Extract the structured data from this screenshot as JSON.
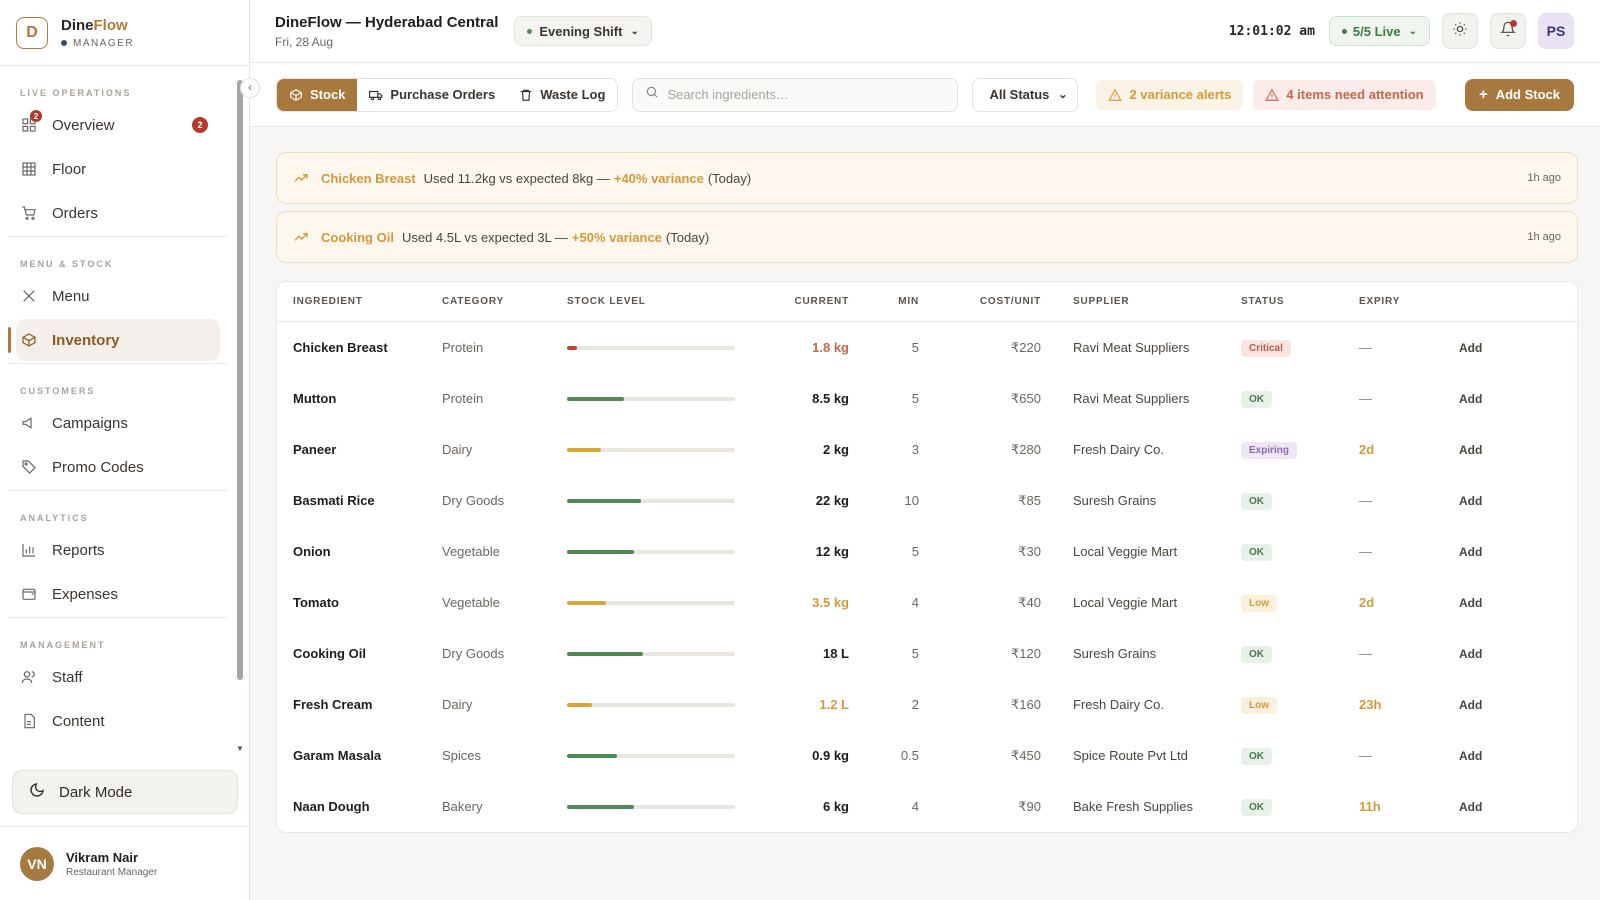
{
  "brand": {
    "name_part1": "Dine",
    "name_part2": "Flow",
    "role": "MANAGER",
    "logo_letter": "D"
  },
  "sidebar": {
    "sections": [
      {
        "label": "LIVE OPERATIONS",
        "items": [
          {
            "label": "Overview",
            "icon": "dashboard-icon",
            "badge": "2",
            "active": false
          },
          {
            "label": "Floor",
            "icon": "grid-icon",
            "active": false
          },
          {
            "label": "Orders",
            "icon": "cart-icon",
            "active": false
          }
        ]
      },
      {
        "label": "MENU & STOCK",
        "items": [
          {
            "label": "Menu",
            "icon": "utensils-icon",
            "active": false
          },
          {
            "label": "Inventory",
            "icon": "package-icon",
            "active": true
          }
        ]
      },
      {
        "label": "CUSTOMERS",
        "items": [
          {
            "label": "Campaigns",
            "icon": "megaphone-icon",
            "active": false
          },
          {
            "label": "Promo Codes",
            "icon": "tag-icon",
            "active": false
          }
        ]
      },
      {
        "label": "ANALYTICS",
        "items": [
          {
            "label": "Reports",
            "icon": "bar-chart-icon",
            "active": false
          },
          {
            "label": "Expenses",
            "icon": "wallet-icon",
            "active": false
          }
        ]
      },
      {
        "label": "MANAGEMENT",
        "items": [
          {
            "label": "Staff",
            "icon": "users-icon",
            "active": false
          },
          {
            "label": "Content",
            "icon": "file-icon",
            "active": false
          }
        ]
      }
    ],
    "dark_mode_label": "Dark Mode",
    "user": {
      "initials": "VN",
      "name": "Vikram Nair",
      "role": "Restaurant Manager"
    }
  },
  "header": {
    "title": "DineFlow — Hyderabad Central",
    "date": "Fri, 28 Aug",
    "shift": "Evening Shift",
    "clock": "12:01:02 am",
    "live": "5/5 Live",
    "avatar": "PS"
  },
  "toolbar": {
    "tabs": [
      {
        "label": "Stock",
        "active": true
      },
      {
        "label": "Purchase Orders",
        "active": false
      },
      {
        "label": "Waste Log",
        "active": false
      }
    ],
    "search_placeholder": "Search ingredients…",
    "status_filter": "All Status",
    "variance_alerts": "2 variance alerts",
    "attention_alerts": "4 items need attention",
    "add_stock": "Add Stock"
  },
  "alerts": [
    {
      "item": "Chicken Breast",
      "text": "Used 11.2kg vs expected 8kg —",
      "variance": "+40% variance",
      "period": "(Today)",
      "time": "1h ago"
    },
    {
      "item": "Cooking Oil",
      "text": "Used 4.5L vs expected 3L —",
      "variance": "+50% variance",
      "period": "(Today)",
      "time": "1h ago"
    }
  ],
  "table": {
    "columns": [
      "INGREDIENT",
      "CATEGORY",
      "STOCK LEVEL",
      "CURRENT",
      "MIN",
      "COST/UNIT",
      "SUPPLIER",
      "STATUS",
      "EXPIRY"
    ],
    "action_label": "Add",
    "rows": [
      {
        "ingredient": "Chicken Breast",
        "category": "Protein",
        "level": 0.06,
        "level_color": "#c0463a",
        "current": "1.8 kg",
        "current_style": "crit",
        "min": "5",
        "cost": "₹220",
        "supplier": "Ravi Meat Suppliers",
        "status": "Critical",
        "status_style": "critical",
        "expiry": "—",
        "expiry_style": ""
      },
      {
        "ingredient": "Mutton",
        "category": "Protein",
        "level": 0.34,
        "level_color": "#4e8a52",
        "current": "8.5 kg",
        "current_style": "",
        "min": "5",
        "cost": "₹650",
        "supplier": "Ravi Meat Suppliers",
        "status": "OK",
        "status_style": "ok",
        "expiry": "—",
        "expiry_style": ""
      },
      {
        "ingredient": "Paneer",
        "category": "Dairy",
        "level": 0.2,
        "level_color": "#d9a63a",
        "current": "2 kg",
        "current_style": "",
        "min": "3",
        "cost": "₹280",
        "supplier": "Fresh Dairy Co.",
        "status": "Expiring",
        "status_style": "expiring",
        "expiry": "2d",
        "expiry_style": "warn"
      },
      {
        "ingredient": "Basmati Rice",
        "category": "Dry Goods",
        "level": 0.44,
        "level_color": "#4e8a52",
        "current": "22 kg",
        "current_style": "",
        "min": "10",
        "cost": "₹85",
        "supplier": "Suresh Grains",
        "status": "OK",
        "status_style": "ok",
        "expiry": "—",
        "expiry_style": ""
      },
      {
        "ingredient": "Onion",
        "category": "Vegetable",
        "level": 0.4,
        "level_color": "#4e8a52",
        "current": "12 kg",
        "current_style": "",
        "min": "5",
        "cost": "₹30",
        "supplier": "Local Veggie Mart",
        "status": "OK",
        "status_style": "ok",
        "expiry": "—",
        "expiry_style": ""
      },
      {
        "ingredient": "Tomato",
        "category": "Vegetable",
        "level": 0.23,
        "level_color": "#d9a63a",
        "current": "3.5 kg",
        "current_style": "warn",
        "min": "4",
        "cost": "₹40",
        "supplier": "Local Veggie Mart",
        "status": "Low",
        "status_style": "low",
        "expiry": "2d",
        "expiry_style": "warn"
      },
      {
        "ingredient": "Cooking Oil",
        "category": "Dry Goods",
        "level": 0.45,
        "level_color": "#4e8a52",
        "current": "18 L",
        "current_style": "",
        "min": "5",
        "cost": "₹120",
        "supplier": "Suresh Grains",
        "status": "OK",
        "status_style": "ok",
        "expiry": "—",
        "expiry_style": ""
      },
      {
        "ingredient": "Fresh Cream",
        "category": "Dairy",
        "level": 0.15,
        "level_color": "#d9a63a",
        "current": "1.2 L",
        "current_style": "warn",
        "min": "2",
        "cost": "₹160",
        "supplier": "Fresh Dairy Co.",
        "status": "Low",
        "status_style": "low",
        "expiry": "23h",
        "expiry_style": "warn"
      },
      {
        "ingredient": "Garam Masala",
        "category": "Spices",
        "level": 0.3,
        "level_color": "#4e8a52",
        "current": "0.9 kg",
        "current_style": "",
        "min": "0.5",
        "cost": "₹450",
        "supplier": "Spice Route Pvt Ltd",
        "status": "OK",
        "status_style": "ok",
        "expiry": "—",
        "expiry_style": ""
      },
      {
        "ingredient": "Naan Dough",
        "category": "Bakery",
        "level": 0.4,
        "level_color": "#4e8a52",
        "current": "6 kg",
        "current_style": "",
        "min": "4",
        "cost": "₹90",
        "supplier": "Bake Fresh Supplies",
        "status": "OK",
        "status_style": "ok",
        "expiry": "11h",
        "expiry_style": "warn"
      }
    ]
  }
}
